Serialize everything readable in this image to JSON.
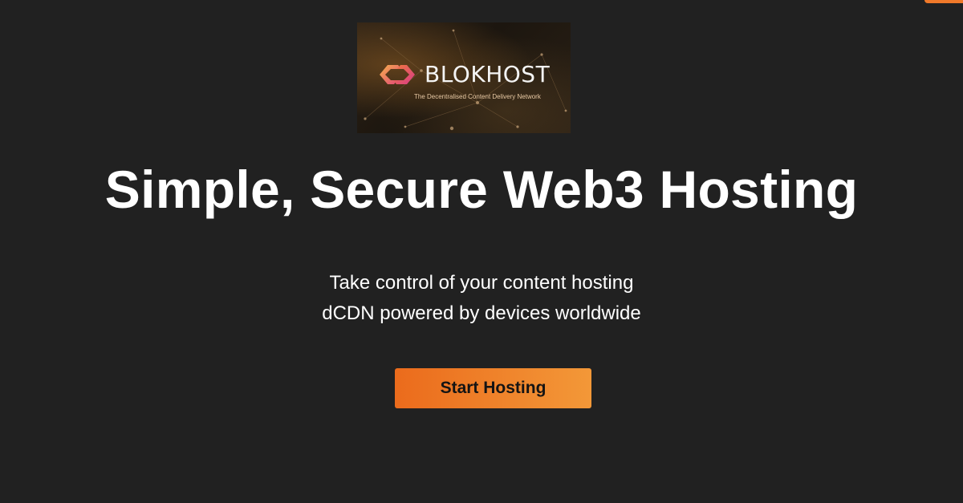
{
  "banner": {
    "brand_name": "BLOKHOST",
    "tagline": "The Decentralised Content Delivery Network",
    "logo_icon": "linked-chain-icon"
  },
  "hero": {
    "headline": "Simple, Secure Web3 Hosting",
    "subtext_lines": [
      "Take control of your content hosting",
      "dCDN powered by devices worldwide"
    ],
    "cta_label": "Start Hosting"
  },
  "colors": {
    "background": "#212121",
    "accent_start": "#eb6b1c",
    "accent_end": "#f39838",
    "text": "#ffffff"
  }
}
